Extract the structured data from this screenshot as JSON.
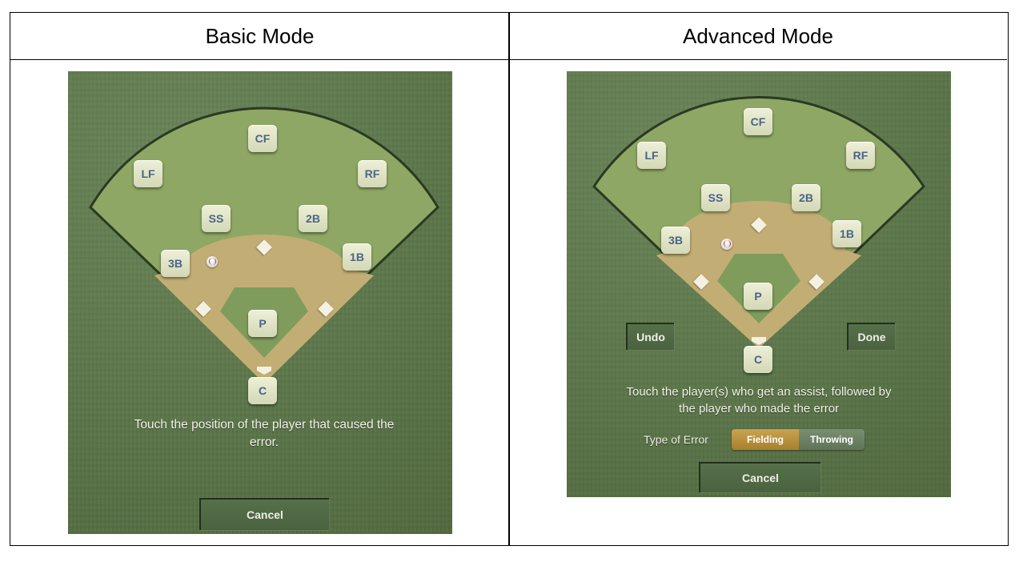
{
  "headers": {
    "basic": "Basic Mode",
    "advanced": "Advanced Mode"
  },
  "basic": {
    "positions": {
      "cf": "CF",
      "lf": "LF",
      "rf": "RF",
      "ss": "SS",
      "second": "2B",
      "third": "3B",
      "first": "1B",
      "pitcher": "P",
      "catcher": "C"
    },
    "instruction_line1": "Touch the position of the player that caused the",
    "instruction_line2": "error.",
    "cancel_label": "Cancel"
  },
  "advanced": {
    "positions": {
      "cf": "CF",
      "lf": "LF",
      "rf": "RF",
      "ss": "SS",
      "second": "2B",
      "third": "3B",
      "first": "1B",
      "pitcher": "P",
      "catcher": "C"
    },
    "undo_label": "Undo",
    "done_label": "Done",
    "instruction_line1": "Touch the player(s) who get an assist, followed by",
    "instruction_line2": "the player who made the error",
    "error_type_label": "Type of Error",
    "error_types": {
      "fielding": "Fielding",
      "throwing": "Throwing"
    },
    "selected_error_type": "Fielding",
    "cancel_label": "Cancel"
  },
  "colors": {
    "outfield": "#8ea765",
    "infield_dirt": "#c2ae74",
    "grass": "#7f9c5c",
    "selected_segment": "#b8913d",
    "background": "#5c7549"
  }
}
